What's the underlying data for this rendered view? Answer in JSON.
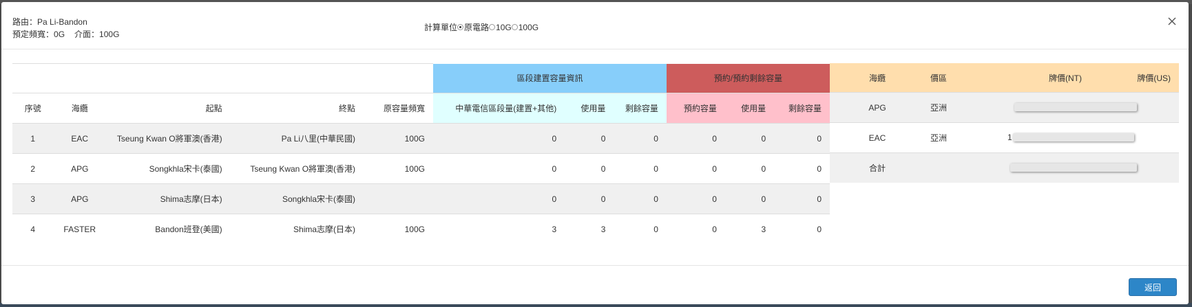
{
  "header": {
    "route_label": "路由：",
    "route_value": "Pa Li-Bandon",
    "bandwidth_label": "預定頻寬：",
    "bandwidth_value": "0G",
    "interface_label": "介面：",
    "interface_value": "100G",
    "unit_label": "計算單位",
    "unit_options": [
      "原電路",
      "10G",
      "100G"
    ],
    "unit_selected": "原電路"
  },
  "groups": {
    "section_info": "區段建置容量資訊",
    "reserve_info": "預約/預約剩餘容量"
  },
  "columns": {
    "index": "序號",
    "cable": "海纜",
    "start": "起點",
    "end": "終點",
    "orig_bandwidth": "原容量頻寬",
    "cht_capacity": "中華電信區段量(建置+其他)",
    "used": "使用量",
    "remaining": "剩餘容量",
    "reserved": "預約容量",
    "reserved_used": "使用量",
    "reserved_remaining": "剩餘容量"
  },
  "rows": [
    {
      "index": "1",
      "cable": "EAC",
      "start": "Tseung Kwan O將軍澳(香港)",
      "end": "Pa Li八里(中華民國)",
      "orig_bandwidth": "100G",
      "cht_capacity": "0",
      "used": "0",
      "remaining": "0",
      "reserved": "0",
      "reserved_used": "0",
      "reserved_remaining": "0"
    },
    {
      "index": "2",
      "cable": "APG",
      "start": "Songkhla宋卡(泰國)",
      "end": "Tseung Kwan O將軍澳(香港)",
      "orig_bandwidth": "100G",
      "cht_capacity": "0",
      "used": "0",
      "remaining": "0",
      "reserved": "0",
      "reserved_used": "0",
      "reserved_remaining": "0"
    },
    {
      "index": "3",
      "cable": "APG",
      "start": "Shima志摩(日本)",
      "end": "Songkhla宋卡(泰國)",
      "orig_bandwidth": "",
      "cht_capacity": "0",
      "used": "0",
      "remaining": "0",
      "reserved": "0",
      "reserved_used": "0",
      "reserved_remaining": "0"
    },
    {
      "index": "4",
      "cable": "FASTER",
      "start": "Bandon班登(美國)",
      "end": "Shima志摩(日本)",
      "orig_bandwidth": "100G",
      "cht_capacity": "3",
      "used": "3",
      "remaining": "0",
      "reserved": "0",
      "reserved_used": "3",
      "reserved_remaining": "0"
    }
  ],
  "price": {
    "headers": {
      "cable": "海纜",
      "region": "價區",
      "list_nt": "牌價(NT)",
      "list_us": "牌價(US)"
    },
    "rows": [
      {
        "cable": "APG",
        "region": "亞洲",
        "nt_prefix": ""
      },
      {
        "cable": "EAC",
        "region": "亞洲",
        "nt_prefix": "1"
      },
      {
        "cable": "合計",
        "region": "",
        "nt_prefix": ""
      }
    ]
  },
  "footer": {
    "back_label": "返回"
  },
  "colors": {
    "section_blue": "#87cefa",
    "section_cyan": "#e0ffff",
    "reserve_red": "#cd5c5c",
    "reserve_pink": "#ffc0cb",
    "price_header": "#ffdead",
    "button_blue": "#2d86c8"
  },
  "icons": {
    "close": "close-icon",
    "radio": "radio-icon"
  }
}
